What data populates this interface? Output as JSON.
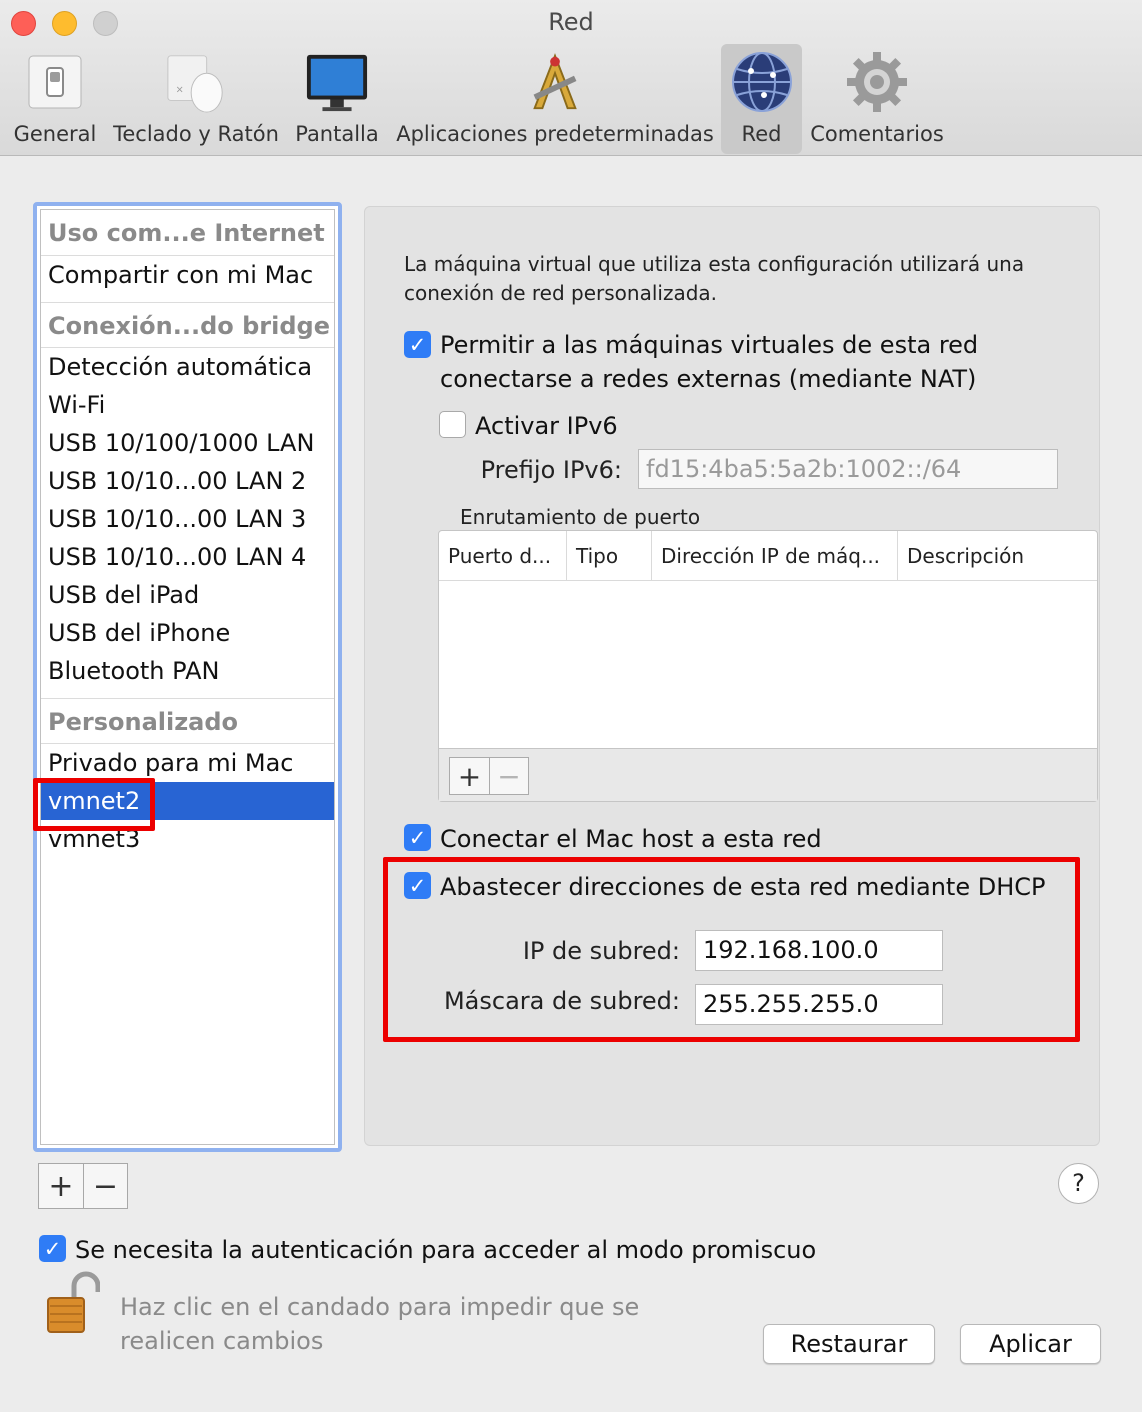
{
  "window": {
    "title": "Red"
  },
  "toolbar": {
    "items": [
      {
        "label": "General",
        "icon": "general-switch-icon"
      },
      {
        "label": "Teclado y Ratón",
        "icon": "mouse-keyboard-icon"
      },
      {
        "label": "Pantalla",
        "icon": "display-icon"
      },
      {
        "label": "Aplicaciones predeterminadas",
        "icon": "applications-icon"
      },
      {
        "label": "Red",
        "icon": "network-globe-icon",
        "selected": true
      },
      {
        "label": "Comentarios",
        "icon": "gear-icon"
      }
    ]
  },
  "sidebar": {
    "groups": [
      {
        "header": "Uso com...e Internet",
        "items": [
          "Compartir con mi Mac"
        ]
      },
      {
        "header": "Conexión...do bridge",
        "items": [
          "Detección automática",
          "Wi-Fi",
          "USB 10/100/1000 LAN",
          "USB 10/10...00 LAN 2",
          "USB 10/10...00 LAN 3",
          "USB 10/10...00 LAN 4",
          "USB del iPad",
          "USB del iPhone",
          "Bluetooth PAN"
        ]
      },
      {
        "header": "Personalizado",
        "items": [
          "Privado para mi Mac",
          "vmnet2",
          "vmnet3"
        ]
      }
    ],
    "selected": "vmnet2",
    "add_label": "+",
    "remove_label": "−"
  },
  "panel": {
    "description": "La máquina virtual que utiliza esta configuración utilizará una conexión de red personalizada.",
    "nat": {
      "checked": true,
      "label_line1": "Permitir a las máquinas virtuales de esta red",
      "label_line2": "conectarse a redes externas (mediante NAT)"
    },
    "ipv6": {
      "checked": false,
      "label": "Activar IPv6",
      "prefix_label": "Prefijo IPv6:",
      "prefix_value": "fd15:4ba5:5a2b:1002::/64"
    },
    "port_forwarding": {
      "title": "Enrutamiento de puerto",
      "columns": [
        "Puerto d...",
        "Tipo",
        "Dirección IP de máq...",
        "Descripción"
      ],
      "rows": [],
      "add_label": "+",
      "remove_label": "−"
    },
    "connect_host": {
      "checked": true,
      "label": "Conectar el Mac host a esta red"
    },
    "dhcp": {
      "checked": true,
      "label": "Abastecer direcciones de esta red mediante DHCP"
    },
    "subnet_ip": {
      "label": "IP de subred:",
      "value": "192.168.100.0"
    },
    "subnet_mask": {
      "label": "Máscara de subred:",
      "value": "255.255.255.0"
    }
  },
  "promiscuous": {
    "checked": true,
    "label": "Se necesita la autenticación para acceder al modo promiscuo"
  },
  "lock": {
    "text": "Haz clic en el candado para impedir que se realicen cambios"
  },
  "buttons": {
    "help": "?",
    "restore": "Restaurar",
    "apply": "Aplicar"
  },
  "colors": {
    "selection": "#2864d3",
    "checkbox": "#2f7cf6",
    "annotation": "#ec0000",
    "focus_ring": "#8fb1ef"
  }
}
